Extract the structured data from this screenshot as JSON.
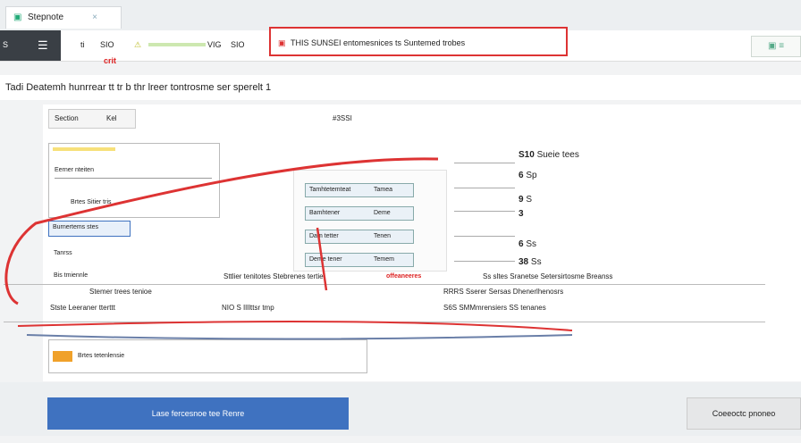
{
  "tab": {
    "label": "Stepnote"
  },
  "nav": {
    "logo_label": "S",
    "c1": "ti",
    "c2": "SIO",
    "c3": "VIG",
    "c4": "SIO",
    "badge_label": "crit"
  },
  "banner": {
    "text": "THIS SUNSEI entomesnices ts Suntemed trobes"
  },
  "title": "Tadi Deatemh hunrrear tt tr b thr lreer tontrosme ser sperelt 1",
  "toolbar": {
    "btn_a": "Section",
    "btn_b": "Kel",
    "id_text": "#3SSI"
  },
  "card1": {
    "rows": [
      "Eerner nteiten",
      "Brtes Sitier tris",
      "Bis tmiennle"
    ]
  },
  "card2": {
    "rows": [
      "Burnertems stes",
      "Tanrss"
    ]
  },
  "inputs": {
    "rows": [
      {
        "a": "Tamhtetemteat",
        "b": "Tamea"
      },
      {
        "a": "Bamhtener",
        "b": "Deme"
      },
      {
        "a": "Dam tetter",
        "b": "Tenen"
      },
      {
        "a": "Deme tener",
        "b": "Temem"
      }
    ]
  },
  "note": {
    "text": "offeaneeres"
  },
  "stats": [
    {
      "value": "S10",
      "label": "Sueie tees"
    },
    {
      "value": "6",
      "label": "Sp"
    },
    {
      "value": "9",
      "label": "S"
    },
    {
      "value": "3",
      "label": ""
    },
    {
      "value": "6",
      "label": "Ss"
    },
    {
      "value": "38",
      "label": "Ss"
    }
  ],
  "line1": {
    "left": "Sttlier tenitotes Stebrenes tertie",
    "right": "Ss sltes Sranetse Setersirtosme Breanss"
  },
  "line2": {
    "left": "Stemer trees tenioe",
    "right": "RRRS Sserer Sersas Dhenerlhenosrs"
  },
  "line3": {
    "left": "Stste Leeraner tterttt",
    "mid": "NIO S IlIlttsr tmp",
    "right": "S6S SMMmrensiers SS tenanes"
  },
  "card3": {
    "text": "Brtes tetenlensie"
  },
  "footer": {
    "primary_label": "Lase fercesnoe tee Renre",
    "secondary_label": "Coeeoctc pnoneo"
  },
  "colors": {
    "accent": "#3f72c0",
    "alert": "#d33",
    "highlight": "#f7e07a"
  }
}
